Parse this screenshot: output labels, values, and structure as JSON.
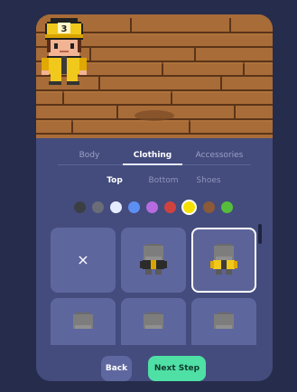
{
  "tabs": {
    "main": [
      {
        "label": "Body",
        "active": false
      },
      {
        "label": "Clothing",
        "active": true
      },
      {
        "label": "Accessories",
        "active": false
      }
    ],
    "sub": [
      {
        "label": "Top",
        "active": true
      },
      {
        "label": "Bottom",
        "active": false
      },
      {
        "label": "Shoes",
        "active": false
      }
    ]
  },
  "colors": {
    "background": "#262c4b",
    "card": "#444c7d",
    "accent": "#4fe0a6",
    "floor": "#a86c38",
    "swatches": [
      "#3b3f44",
      "#6a6d77",
      "#e6ecff",
      "#5c8ff2",
      "#b66be0",
      "#d0423f",
      "#f6e000",
      "#8a5a39",
      "#56bd3c"
    ],
    "selected_swatch": "#f6e000"
  },
  "avatar": {
    "hat_badge": "3",
    "icon": "character-avatar"
  },
  "items": {
    "tiles": [
      {
        "kind": "none",
        "icon": "none-x-icon",
        "label": "×",
        "selected": false
      },
      {
        "kind": "garment",
        "icon": "black-jacket-icon",
        "selected": false
      },
      {
        "kind": "garment",
        "icon": "yellow-jacket-icon",
        "selected": true
      },
      {
        "kind": "garment",
        "icon": "gray-silhouette-icon",
        "selected": false
      },
      {
        "kind": "garment",
        "icon": "gray-silhouette-icon",
        "selected": false
      },
      {
        "kind": "garment",
        "icon": "gray-silhouette-icon",
        "selected": false
      }
    ]
  },
  "footer": {
    "back_label": "Back",
    "next_label": "Next Step"
  }
}
